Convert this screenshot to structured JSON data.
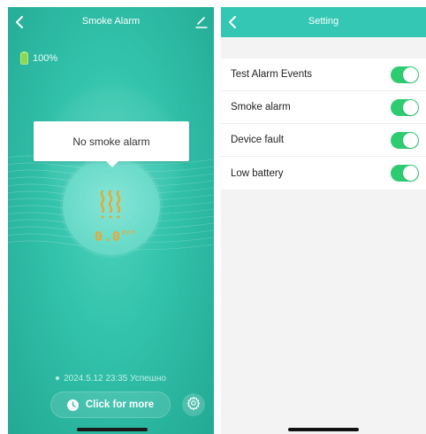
{
  "smoke_screen": {
    "title": "Smoke Alarm",
    "battery": "100%",
    "bubble_text": "No smoke alarm",
    "reading_value": "0.0",
    "reading_unit": "ppm",
    "status_text": "2024.5.12 23:35 Успешно",
    "more_button_label": "Click for more",
    "icons": [
      "back-chevron-icon",
      "edit-icon",
      "battery-icon",
      "smoke-icon",
      "clock-icon",
      "gear-icon"
    ]
  },
  "setting_screen": {
    "title": "Setting",
    "items": [
      {
        "label": "Test Alarm Events",
        "enabled": true
      },
      {
        "label": "Smoke alarm",
        "enabled": true
      },
      {
        "label": "Device fault",
        "enabled": true
      },
      {
        "label": "Low battery",
        "enabled": true
      }
    ]
  },
  "colors": {
    "teal_background": "#33c3ac",
    "header_teal": "#34c7b3",
    "toggle_on": "#2ecc71",
    "reading_amber": "#e8a832"
  }
}
